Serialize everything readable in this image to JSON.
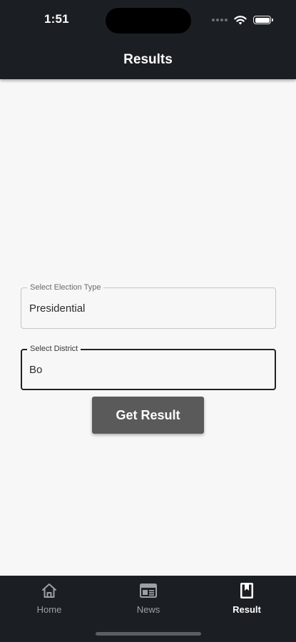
{
  "status_bar": {
    "time": "1:51"
  },
  "header": {
    "title": "Results"
  },
  "form": {
    "election_type": {
      "label": "Select Election Type",
      "value": "Presidential"
    },
    "district": {
      "label": "Select District",
      "value": "Bo"
    },
    "submit_label": "Get Result"
  },
  "nav": {
    "items": [
      {
        "label": "Home",
        "icon": "home-icon"
      },
      {
        "label": "News",
        "icon": "newspaper-icon"
      },
      {
        "label": "Result",
        "icon": "book-icon",
        "active": true
      }
    ]
  },
  "colors": {
    "bar_background": "#1b1f24",
    "page_background": "#f7f7f7",
    "button": "#5a5a5a",
    "nav_inactive": "#9aa0a6",
    "nav_active": "#ffffff"
  }
}
